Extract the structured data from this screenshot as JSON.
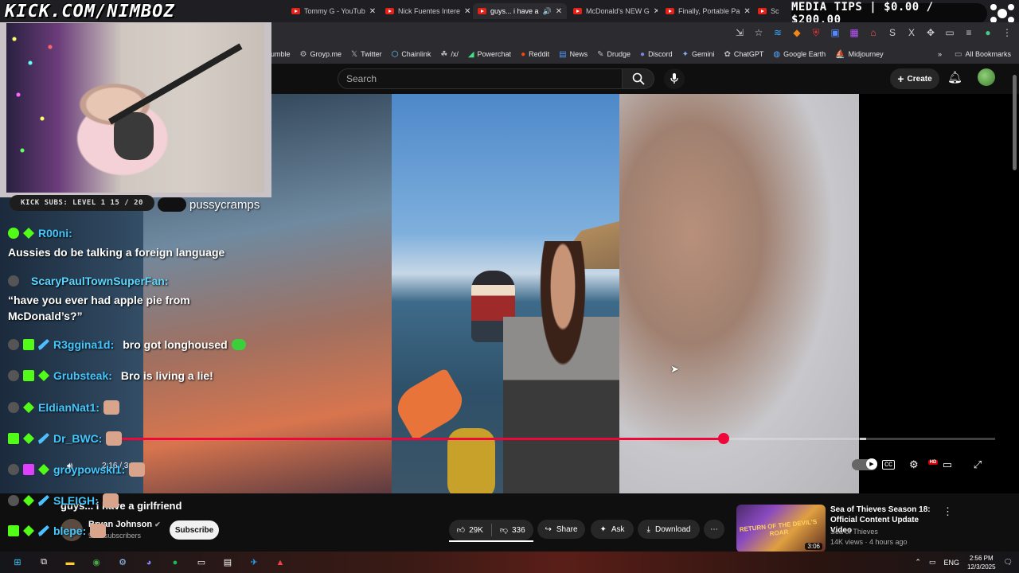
{
  "overlay": {
    "kick_url": "KICK.COM/NIMBOZ",
    "media_tips": "MEDIA TIPS | $0.00 / $200.00",
    "kick_subs": "KICK SUBS: LEVEL 1 15 / 20",
    "highlight_user": "pussycramps"
  },
  "browser": {
    "tabs": [
      {
        "label": "Tommy G - YouTub"
      },
      {
        "label": "Nick Fuentes Intere"
      },
      {
        "label": "guys... i have a"
      },
      {
        "label": "McDonald's NEW G"
      },
      {
        "label": "Finally, Portable Pa"
      },
      {
        "label": "Sc"
      }
    ],
    "bookmarks": [
      {
        "label": "umble",
        "icon": "rumble-icon"
      },
      {
        "label": "Groyp.me",
        "icon": "groyp-icon"
      },
      {
        "label": "Twitter",
        "icon": "x-icon"
      },
      {
        "label": "Chainlink",
        "icon": "chainlink-icon"
      },
      {
        "label": "/x/",
        "icon": "board-icon"
      },
      {
        "label": "Powerchat",
        "icon": "powerchat-icon"
      },
      {
        "label": "Reddit",
        "icon": "reddit-icon"
      },
      {
        "label": "News",
        "icon": "news-icon"
      },
      {
        "label": "Drudge",
        "icon": "drudge-icon"
      },
      {
        "label": "Discord",
        "icon": "discord-icon"
      },
      {
        "label": "Gemini",
        "icon": "gemini-icon"
      },
      {
        "label": "ChatGPT",
        "icon": "chatgpt-icon"
      },
      {
        "label": "Google Earth",
        "icon": "earth-icon"
      },
      {
        "label": "Midjourney",
        "icon": "midjourney-icon"
      }
    ],
    "all_bookmarks": "All Bookmarks"
  },
  "youtube": {
    "search_placeholder": "Search",
    "create_label": "Create",
    "time": "2:16 / 3:09",
    "progress_fraction": 0.69,
    "video_title": "guys... i have a girlfriend",
    "channel_name": "Bryan Johnson",
    "channel_subs": "93M subscribers",
    "subscribe_label": "Subscribe",
    "likes": "29K",
    "dislikes": "336",
    "share_label": "Share",
    "ask_label": "Ask",
    "download_label": "Download",
    "recommended": {
      "title": "Sea of Thieves Season 18: Official Content Update Video",
      "channel": "Sea of Thieves",
      "meta": "14K views · 4 hours ago",
      "duration": "3:06",
      "thumb_text": "RETURN OF THE DEVIL'S ROAR"
    },
    "hd_badge": "HD"
  },
  "chat": [
    {
      "user": "R00ni:",
      "text": "",
      "badges": [
        "sub",
        "mod"
      ]
    },
    {
      "user": "",
      "text": "Aussies do be talking a foreign language",
      "badges": []
    },
    {
      "user": "ScaryPaulTownSuperFan:",
      "text": "",
      "badges": [
        "avatar"
      ]
    },
    {
      "user": "",
      "text": "“have you ever had apple pie from",
      "badges": []
    },
    {
      "user": "",
      "text": "McDonald’s?”",
      "badges": []
    },
    {
      "user": "R3ggina1d:",
      "text": "bro got longhoused",
      "badges": [
        "avatar",
        "sub",
        "sword"
      ]
    },
    {
      "user": "Grubsteak:",
      "text": "Bro is living a lie!",
      "badges": [
        "avatar",
        "sub",
        "mod"
      ]
    },
    {
      "user": "EldianNat1:",
      "text": "",
      "badges": [
        "avatar",
        "mod"
      ]
    },
    {
      "user": "Dr_BWC:",
      "text": "",
      "badges": [
        "sub",
        "mod",
        "sword"
      ]
    },
    {
      "user": "groypowski1:",
      "text": "",
      "badges": [
        "avatar",
        "vip",
        "mod"
      ]
    },
    {
      "user": "SLEIGH:",
      "text": "",
      "badges": [
        "avatar",
        "mod",
        "sword"
      ]
    },
    {
      "user": "blepe:",
      "text": "",
      "badges": [
        "sub",
        "mod",
        "sword"
      ]
    }
  ],
  "taskbar": {
    "lang": "ENG",
    "time": "2:56 PM",
    "date": "12/3/2025"
  },
  "colors": {
    "youtube_red": "#f0073a",
    "kick_green": "#53fc18",
    "chat_name_blue": "#43c7ff"
  }
}
